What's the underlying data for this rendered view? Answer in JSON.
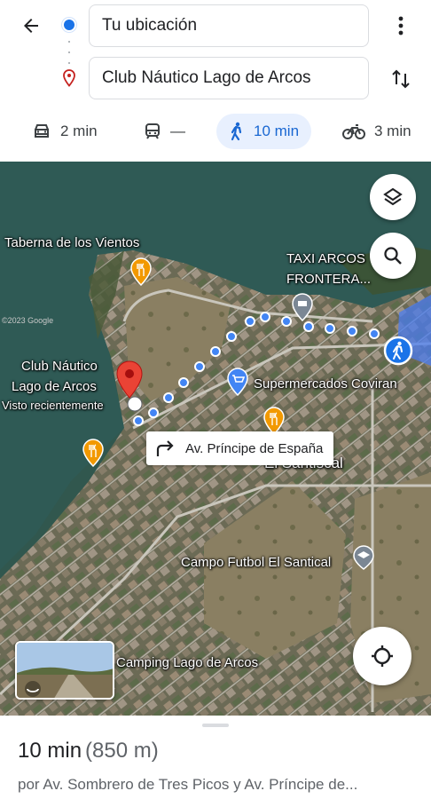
{
  "header": {
    "origin": "Tu ubicación",
    "destination": "Club Náutico Lago de Arcos",
    "back_icon": "arrow-back-icon",
    "more_icon": "more-vert-icon",
    "swap_icon": "swap-vert-icon"
  },
  "modes": [
    {
      "icon": "car-icon",
      "label": "2 min",
      "active": false
    },
    {
      "icon": "train-icon",
      "label": "—",
      "active": false
    },
    {
      "icon": "walk-icon",
      "label": "10 min",
      "active": true
    },
    {
      "icon": "bike-icon",
      "label": "3 min",
      "active": false
    }
  ],
  "map": {
    "labels": {
      "taberna": "Taberna de los Vientos",
      "taxi_1": "TAXI ARCOS",
      "taxi_2": "FRONTERA...",
      "club_1": "Club Náutico",
      "club_2": "Lago de Arcos",
      "club_3": "Visto recientemente",
      "super": "Supermercados Coviran",
      "santiscal": "El Santiscal",
      "campo": "Campo Futbol El Santical",
      "camping": "Camping Lago de Arcos",
      "google": "©2023 Google"
    },
    "callout": "Av. Príncipe de España"
  },
  "summary": {
    "duration": "10 min",
    "distance": "(850 m)",
    "via": "por Av. Sombrero de Tres Picos y Av. Príncipe de..."
  },
  "colors": {
    "accent": "#1a73e8",
    "route_dot": "#4285f4",
    "pin_red": "#ea4335",
    "active_mode_bg": "#e8f0fe"
  }
}
